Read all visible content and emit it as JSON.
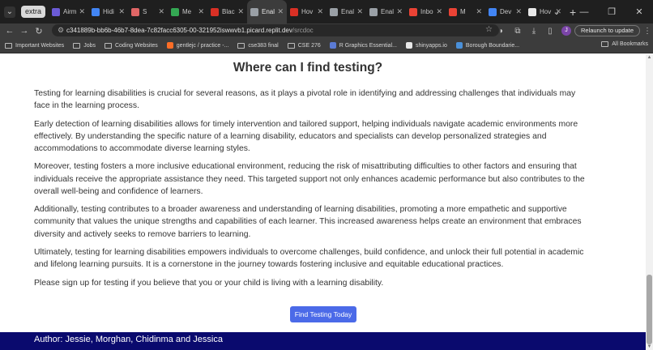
{
  "browser": {
    "tab_group_label": "extra",
    "tabs": [
      {
        "title": "Airm",
        "favicon_color": "#6b5bd6",
        "active": false
      },
      {
        "title": "Hidi",
        "favicon_color": "#4285f4",
        "active": false
      },
      {
        "title": "S",
        "favicon_color": "#e06666",
        "active": false
      },
      {
        "title": "Me",
        "favicon_color": "#34a853",
        "active": false
      },
      {
        "title": "Blac",
        "favicon_color": "#d93025",
        "active": false
      },
      {
        "title": "Enal",
        "favicon_color": "#9aa0a6",
        "active": true
      },
      {
        "title": "Hov",
        "favicon_color": "#d93025",
        "active": false
      },
      {
        "title": "Enal",
        "favicon_color": "#9aa0a6",
        "active": false
      },
      {
        "title": "Enal",
        "favicon_color": "#9aa0a6",
        "active": false
      },
      {
        "title": "Inbo",
        "favicon_color": "#ea4335",
        "active": false
      },
      {
        "title": "M",
        "favicon_color": "#ea4335",
        "active": false
      },
      {
        "title": "Dev",
        "favicon_color": "#4285f4",
        "active": false
      },
      {
        "title": "Hov",
        "favicon_color": "#e8e8e8",
        "active": false
      }
    ],
    "url_main": "c341889b-bb6b-46b7-8dea-7c82facc6305-00-321952iswwvb1.picard.replit.dev",
    "url_path": "/srcdoc",
    "profile_initial": "J",
    "relaunch_label": "Relaunch to update",
    "bookmarks": [
      {
        "label": "Important Websites",
        "type": "folder"
      },
      {
        "label": "Jobs",
        "type": "folder"
      },
      {
        "label": "Coding Websites",
        "type": "folder"
      },
      {
        "label": "gentlejc / practice -...",
        "type": "site",
        "color": "#fc6d26"
      },
      {
        "label": "cse383 final",
        "type": "folder"
      },
      {
        "label": "CSE 276",
        "type": "folder"
      },
      {
        "label": "R Graphics Essential...",
        "type": "site",
        "color": "#5b7bd5"
      },
      {
        "label": "shinyapps.io",
        "type": "site",
        "color": "#e8e8e8"
      },
      {
        "label": "Borough Boundarie...",
        "type": "site",
        "color": "#4a90d9"
      }
    ],
    "all_bookmarks_label": "All Bookmarks"
  },
  "page": {
    "title": "Where can I find testing?",
    "paragraphs": [
      "Testing for learning disabilities is crucial for several reasons, as it plays a pivotal role in identifying and addressing challenges that individuals may face in the learning process.",
      "Early detection of learning disabilities allows for timely intervention and tailored support, helping individuals navigate academic environments more effectively. By understanding the specific nature of a learning disability, educators and specialists can develop personalized strategies and accommodations to accommodate diverse learning styles.",
      "Moreover, testing fosters a more inclusive educational environment, reducing the risk of misattributing difficulties to other factors and ensuring that individuals receive the appropriate assistance they need. This targeted support not only enhances academic performance but also contributes to the overall well-being and confidence of learners.",
      "Additionally, testing contributes to a broader awareness and understanding of learning disabilities, promoting a more empathetic and supportive community that values the unique strengths and capabilities of each learner. This increased awareness helps create an environment that embraces diversity and actively seeks to remove barriers to learning.",
      "Ultimately, testing for learning disabilities empowers individuals to overcome challenges, build confidence, and unlock their full potential in academic and lifelong learning pursuits. It is a cornerstone in the journey towards fostering inclusive and equitable educational practices.",
      "Please sign up for testing if you believe that you or your child is living with a learning disability."
    ],
    "cta_label": "Find Testing Today",
    "cta_color": "#4b6ae8",
    "footer_text": "Author: Jessie, Morghan, Chidinma and Jessica",
    "footer_color": "#0a0a6e"
  }
}
